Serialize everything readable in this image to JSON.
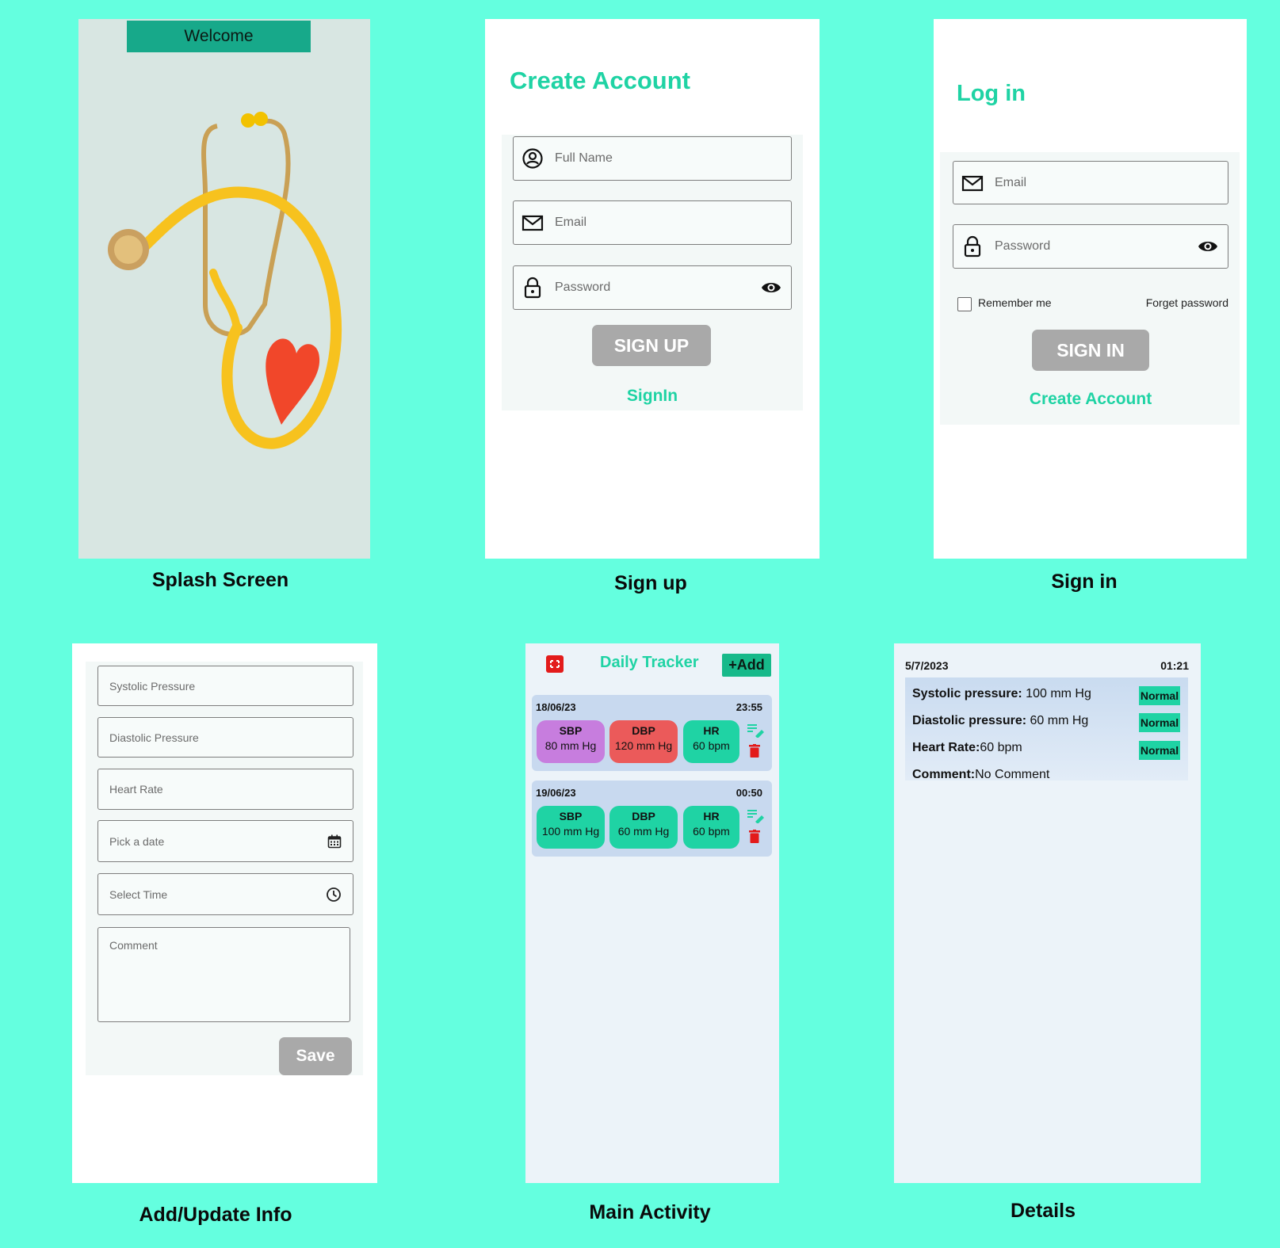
{
  "splash": {
    "banner": "Welcome",
    "caption": "Splash Screen"
  },
  "signup": {
    "title": "Create Account",
    "full_name_placeholder": "Full Name",
    "email_placeholder": "Email",
    "password_placeholder": "Password",
    "button": "SIGN UP",
    "link": "SignIn",
    "caption": "Sign up"
  },
  "signin": {
    "title": "Log in",
    "email_placeholder": "Email",
    "password_placeholder": "Password",
    "remember": "Remember me",
    "forget": "Forget password",
    "button": "SIGN IN",
    "link": "Create Account",
    "caption": "Sign in"
  },
  "addinfo": {
    "systolic": "Systolic Pressure",
    "diastolic": "Diastolic Pressure",
    "heart_rate": "Heart Rate",
    "date": "Pick a date",
    "time": "Select Time",
    "comment": "Comment",
    "save": "Save",
    "caption": "Add/Update Info"
  },
  "main": {
    "title": "Daily Tracker",
    "add": "+Add",
    "caption": "Main Activity",
    "records": [
      {
        "date": "18/06/23",
        "time": "23:55",
        "sbp_label": "SBP",
        "sbp": "80 mm Hg",
        "dbp_label": "DBP",
        "dbp": "120 mm Hg",
        "hr_label": "HR",
        "hr": "60 bpm"
      },
      {
        "date": "19/06/23",
        "time": "00:50",
        "sbp_label": "SBP",
        "sbp": "100 mm Hg",
        "dbp_label": "DBP",
        "dbp": "60 mm Hg",
        "hr_label": "HR",
        "hr": "60 bpm"
      }
    ]
  },
  "details": {
    "date": "5/7/2023",
    "time": "01:21",
    "systolic_label": "Systolic pressure:",
    "systolic_value": " 100 mm Hg",
    "diastolic_label": "Diastolic pressure:",
    "diastolic_value": " 60 mm Hg",
    "hr_label": "Heart Rate:",
    "hr_value": "60 bpm",
    "comment_label": "Comment:",
    "comment_value": "No Comment",
    "status": "Normal",
    "caption": "Details"
  },
  "colors": {
    "background": "#64FFDF",
    "accent": "#1FD3A4",
    "pill_purple": "#C77DDE",
    "pill_red": "#EB5A5A",
    "pill_green": "#1FD3A4",
    "delete": "#E31B1B"
  }
}
